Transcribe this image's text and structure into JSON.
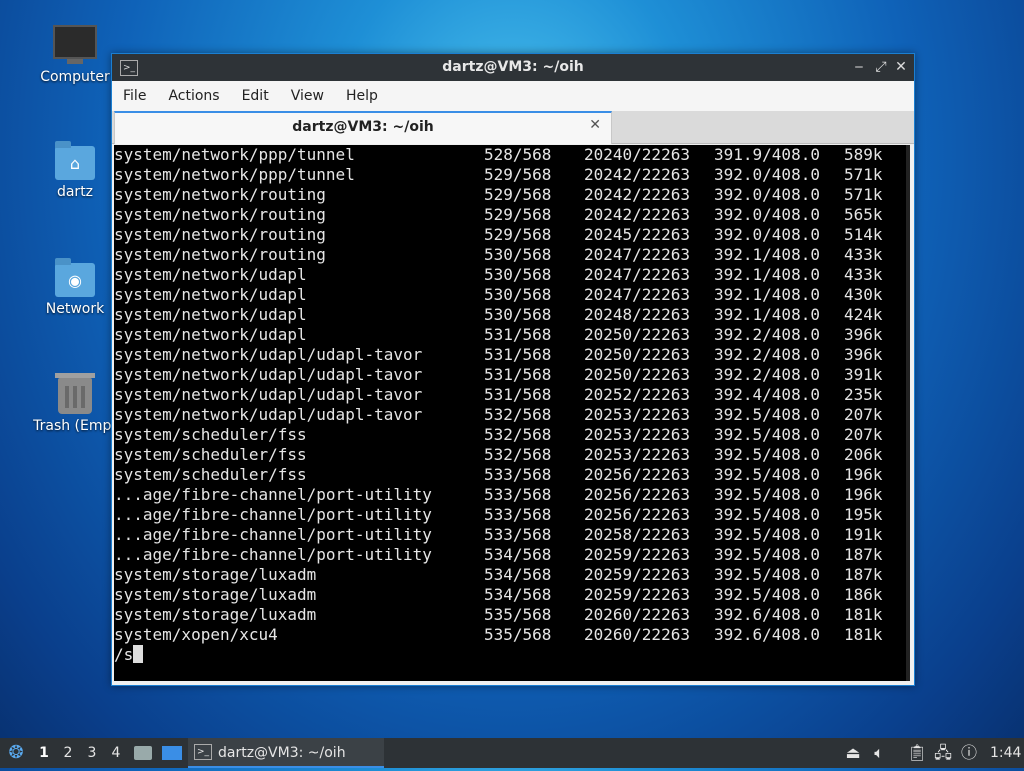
{
  "desktop": {
    "icons": [
      {
        "label": "Computer",
        "icon": "computer-icon"
      },
      {
        "label": "dartz",
        "icon": "home-folder-icon"
      },
      {
        "label": "Network",
        "icon": "network-folder-icon"
      },
      {
        "label": "Trash (Empt",
        "icon": "trash-icon"
      }
    ]
  },
  "window": {
    "title": "dartz@VM3: ~/oih",
    "controls": {
      "minimize": "‒",
      "maximize": "⤢",
      "close": "✕"
    },
    "menu": [
      "File",
      "Actions",
      "Edit",
      "View",
      "Help"
    ],
    "tab": {
      "title": "dartz@VM3: ~/oih",
      "close": "✕"
    }
  },
  "terminal": {
    "rows": [
      [
        "system/network/ppp/tunnel",
        "528/568",
        "20240/22263",
        "391.9/408.0",
        "589k"
      ],
      [
        "system/network/ppp/tunnel",
        "529/568",
        "20242/22263",
        "392.0/408.0",
        "571k"
      ],
      [
        "system/network/routing",
        "529/568",
        "20242/22263",
        "392.0/408.0",
        "571k"
      ],
      [
        "system/network/routing",
        "529/568",
        "20242/22263",
        "392.0/408.0",
        "565k"
      ],
      [
        "system/network/routing",
        "529/568",
        "20245/22263",
        "392.0/408.0",
        "514k"
      ],
      [
        "system/network/routing",
        "530/568",
        "20247/22263",
        "392.1/408.0",
        "433k"
      ],
      [
        "system/network/udapl",
        "530/568",
        "20247/22263",
        "392.1/408.0",
        "433k"
      ],
      [
        "system/network/udapl",
        "530/568",
        "20247/22263",
        "392.1/408.0",
        "430k"
      ],
      [
        "system/network/udapl",
        "530/568",
        "20248/22263",
        "392.1/408.0",
        "424k"
      ],
      [
        "system/network/udapl",
        "531/568",
        "20250/22263",
        "392.2/408.0",
        "396k"
      ],
      [
        "system/network/udapl/udapl-tavor",
        "531/568",
        "20250/22263",
        "392.2/408.0",
        "396k"
      ],
      [
        "system/network/udapl/udapl-tavor",
        "531/568",
        "20250/22263",
        "392.2/408.0",
        "391k"
      ],
      [
        "system/network/udapl/udapl-tavor",
        "531/568",
        "20252/22263",
        "392.4/408.0",
        "235k"
      ],
      [
        "system/network/udapl/udapl-tavor",
        "532/568",
        "20253/22263",
        "392.5/408.0",
        "207k"
      ],
      [
        "system/scheduler/fss",
        "532/568",
        "20253/22263",
        "392.5/408.0",
        "207k"
      ],
      [
        "system/scheduler/fss",
        "532/568",
        "20253/22263",
        "392.5/408.0",
        "206k"
      ],
      [
        "system/scheduler/fss",
        "533/568",
        "20256/22263",
        "392.5/408.0",
        "196k"
      ],
      [
        "...age/fibre-channel/port-utility",
        "533/568",
        "20256/22263",
        "392.5/408.0",
        "196k"
      ],
      [
        "...age/fibre-channel/port-utility",
        "533/568",
        "20256/22263",
        "392.5/408.0",
        "195k"
      ],
      [
        "...age/fibre-channel/port-utility",
        "533/568",
        "20258/22263",
        "392.5/408.0",
        "191k"
      ],
      [
        "...age/fibre-channel/port-utility",
        "534/568",
        "20259/22263",
        "392.5/408.0",
        "187k"
      ],
      [
        "system/storage/luxadm",
        "534/568",
        "20259/22263",
        "392.5/408.0",
        "187k"
      ],
      [
        "system/storage/luxadm",
        "534/568",
        "20259/22263",
        "392.5/408.0",
        "186k"
      ],
      [
        "system/storage/luxadm",
        "535/568",
        "20260/22263",
        "392.6/408.0",
        "181k"
      ],
      [
        "system/xopen/xcu4",
        "535/568",
        "20260/22263",
        "392.6/408.0",
        "181k"
      ]
    ],
    "prompt": "/s"
  },
  "taskbar": {
    "workspaces": [
      "1",
      "2",
      "3",
      "4"
    ],
    "active_workspace": "1",
    "task_label": "dartz@VM3: ~/oih",
    "clock": "1:44"
  }
}
